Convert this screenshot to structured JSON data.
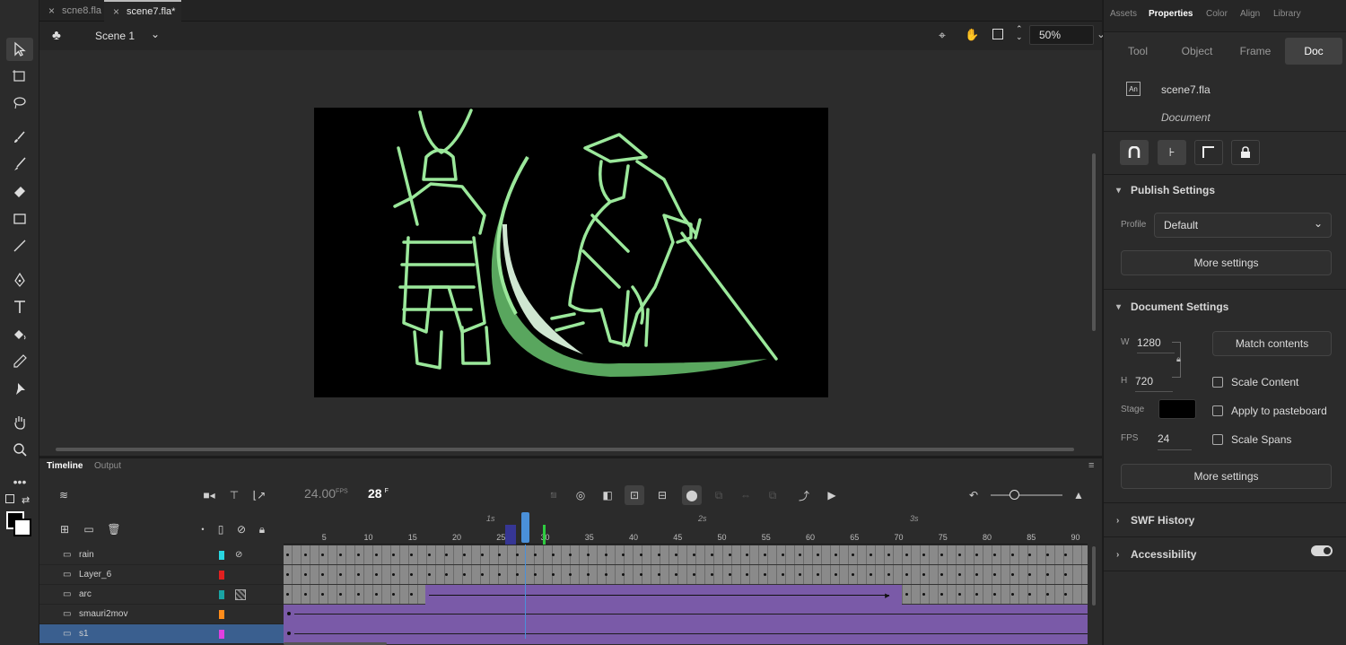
{
  "tabs": [
    "scne8.fla",
    "scene7.fla*"
  ],
  "scene": {
    "name": "Scene 1",
    "zoom": "50%"
  },
  "panel_tabs": [
    "Assets",
    "Properties",
    "Color",
    "Align",
    "Library"
  ],
  "sub_tabs": [
    "Tool",
    "Object",
    "Frame",
    "Doc"
  ],
  "doc": {
    "badge": "An",
    "filename": "scene7.fla",
    "type": "Document"
  },
  "publish": {
    "title": "Publish Settings",
    "profile_label": "Profile",
    "profile_value": "Default",
    "more": "More settings"
  },
  "document_settings": {
    "title": "Document Settings",
    "w_label": "W",
    "w": "1280",
    "h_label": "H",
    "h": "720",
    "stage_label": "Stage",
    "stage_color": "#000000",
    "fps_label": "FPS",
    "fps": "24",
    "match": "Match contents",
    "scale_content": "Scale Content",
    "apply_pasteboard": "Apply to pasteboard",
    "scale_spans": "Scale Spans",
    "more": "More settings"
  },
  "swf_history": "SWF History",
  "accessibility": "Accessibility",
  "timeline": {
    "tabs": [
      "Timeline",
      "Output"
    ],
    "fps": "24.00",
    "fps_unit": "FPS",
    "frame": "28",
    "frame_unit": "F",
    "seconds": [
      "1s",
      "2s",
      "3s"
    ],
    "ruler": [
      "5",
      "10",
      "15",
      "20",
      "25",
      "30",
      "35",
      "40",
      "45",
      "50",
      "55",
      "60",
      "65",
      "70",
      "75",
      "80",
      "85",
      "90"
    ],
    "layers": [
      {
        "name": "rain",
        "color": "#29d6e0"
      },
      {
        "name": "Layer_6",
        "color": "#e02020"
      },
      {
        "name": "arc",
        "color": "#1aa3a3"
      },
      {
        "name": "smauri2mov",
        "color": "#ff8c1a"
      },
      {
        "name": "s1",
        "color": "#e040e0"
      }
    ]
  }
}
